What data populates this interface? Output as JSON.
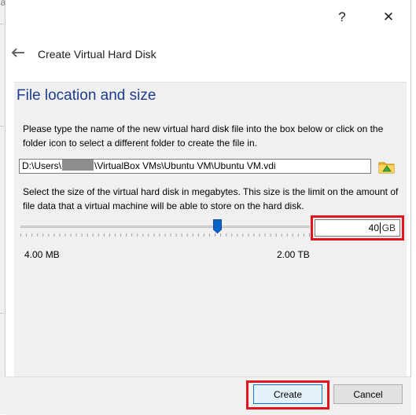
{
  "background": {
    "fragment_text": "vianaaer"
  },
  "titlebar": {
    "help_symbol": "?",
    "close_symbol": "✕"
  },
  "wizard": {
    "title": "Create Virtual Hard Disk"
  },
  "section": {
    "title": "File location and size",
    "description": "Please type the name of the new virtual hard disk file into the box below or click on the folder icon to select a different folder to create the file in."
  },
  "file_path": {
    "prefix": "D:\\Users\\",
    "suffix": "\\VirtualBox VMs\\Ubuntu VM\\Ubuntu VM.vdi"
  },
  "size": {
    "description": "Select the size of the virtual hard disk in megabytes. This size is the limit on the amount of file data that a virtual machine will be able to store on the hard disk.",
    "value": "40",
    "unit": "GB",
    "min_label": "4.00 MB",
    "max_label": "2.00 TB",
    "slider_position_fraction": 0.68
  },
  "buttons": {
    "create": "Create",
    "cancel": "Cancel"
  },
  "colors": {
    "section_title": "#1e3c8c",
    "highlight": "#e0161e",
    "slider_thumb": "#0a64c8",
    "folder_icon": "#f0b429"
  },
  "icons": {
    "back": "back-arrow-icon",
    "folder": "folder-icon",
    "help": "help-icon",
    "close": "close-icon"
  }
}
